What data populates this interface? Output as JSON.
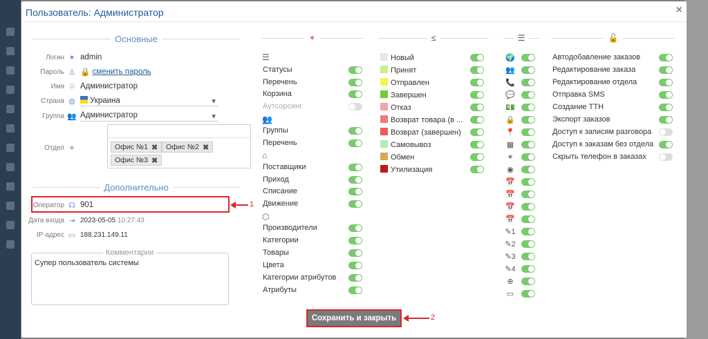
{
  "modal": {
    "title": "Пользователь: Администратор",
    "close_icon": "×"
  },
  "basic": {
    "title": "Основные",
    "login_label": "Логин",
    "login_value": "admin",
    "password_label": "Пароль",
    "password_link": "сменить пароль",
    "name_label": "Имя",
    "name_value": "Администратор",
    "country_label": "Страна",
    "country_value": "Украина",
    "group_label": "Группа",
    "group_value": "Администратор",
    "dept_label": "Отдел",
    "dept_tags": [
      "Офис №1",
      "Офис №2",
      "Офис №3"
    ]
  },
  "extra": {
    "title": "Дополнительно",
    "operator_label": "Оператор",
    "operator_value": "901",
    "login_date_label": "Дата входа",
    "login_date": "2023-05-05",
    "login_time": "10:27:43",
    "ip_label": "IP-адрес",
    "ip_value": "188.231.149.11"
  },
  "comment": {
    "legend": "Комментарии",
    "text": "Супер пользователь системы"
  },
  "perms": {
    "items": [
      {
        "label": "Статусы",
        "on": true
      },
      {
        "label": "Перечень",
        "on": true
      },
      {
        "label": "Корзина",
        "on": true
      },
      {
        "label": "Аутсорсинг",
        "on": false
      },
      {
        "label": "Группы",
        "on": true
      },
      {
        "label": "Перечень",
        "on": true
      },
      {
        "label": "Поставщики",
        "on": true
      },
      {
        "label": "Приход",
        "on": true
      },
      {
        "label": "Списание",
        "on": true
      },
      {
        "label": "Движение",
        "on": true
      },
      {
        "label": "Производители",
        "on": true
      },
      {
        "label": "Категории",
        "on": true
      },
      {
        "label": "Товары",
        "on": true
      },
      {
        "label": "Цвета",
        "on": true
      },
      {
        "label": "Категории атрибутов",
        "on": true
      },
      {
        "label": "Атрибуты",
        "on": true
      }
    ]
  },
  "statuses": {
    "items": [
      {
        "label": "Новый",
        "color": "#e6e6e6"
      },
      {
        "label": "Принят",
        "color": "#c8f08c"
      },
      {
        "label": "Отправлен",
        "color": "#f5f54a"
      },
      {
        "label": "Завершен",
        "color": "#6ccc3c"
      },
      {
        "label": "Отказ",
        "color": "#f5a5a5"
      },
      {
        "label": "Возврат товара (в ...",
        "color": "#f07878"
      },
      {
        "label": "Возврат (завершен)",
        "color": "#f05a5a"
      },
      {
        "label": "Самовывоз",
        "color": "#b4ecb4"
      },
      {
        "label": "Обмен",
        "color": "#d8a850"
      },
      {
        "label": "Утилизация",
        "color": "#c01818"
      }
    ]
  },
  "columns": {
    "icons": [
      "globe-icon",
      "users-icon",
      "phone-icon",
      "chat-icon",
      "money-icon",
      "lock-icon",
      "pin-icon",
      "barcode-icon",
      "tree-icon",
      "user-icon",
      "cal1-icon",
      "cal2-icon",
      "cal3-icon",
      "cal4-icon",
      "pen1-icon",
      "pen2-icon",
      "pen3-icon",
      "pen4-icon",
      "web-icon",
      "monitor-icon"
    ],
    "glyphs": [
      "🌍",
      "👥",
      "📞",
      "💬",
      "💵",
      "🔒",
      "📍",
      "▦",
      "⚹",
      "◉",
      "📅",
      "📅",
      "📅",
      "📅",
      "✎1",
      "✎2",
      "✎3",
      "✎4",
      "⊕",
      "▭"
    ]
  },
  "rights": {
    "items": [
      {
        "label": "Автодобавление заказов",
        "on": true
      },
      {
        "label": "Редактирование заказа",
        "on": true
      },
      {
        "label": "Редактирование отдела",
        "on": true
      },
      {
        "label": "Отправка SMS",
        "on": true
      },
      {
        "label": "Создание ТТН",
        "on": true
      },
      {
        "label": "Экспорт заказов",
        "on": true
      },
      {
        "label": "Доступ к записям разговора",
        "on": false
      },
      {
        "label": "Доступ к заказам без отдела",
        "on": true
      },
      {
        "label": "Скрыть телефон в заказах",
        "on": false
      }
    ]
  },
  "save_label": "Сохранить и закрыть",
  "annotations": {
    "a1": "1",
    "a2": "2"
  }
}
